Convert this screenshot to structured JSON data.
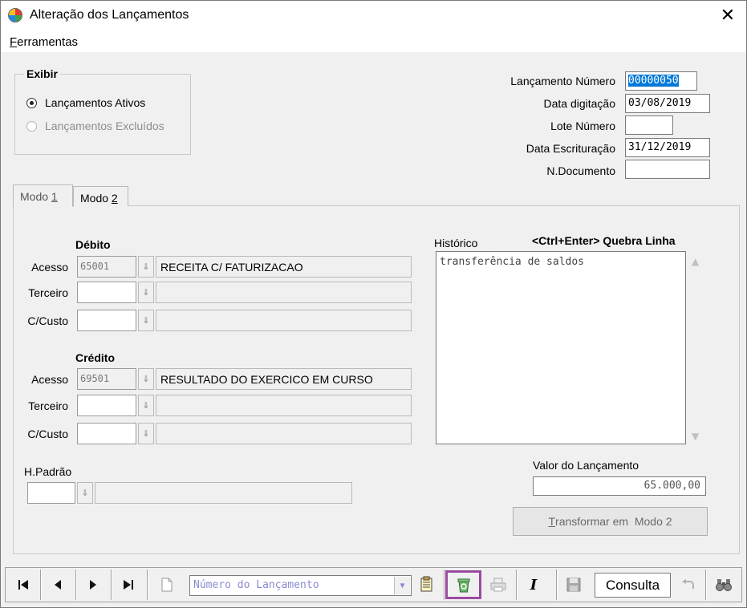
{
  "window": {
    "title": "Alteração dos Lançamentos",
    "close_glyph": "✕"
  },
  "menu": {
    "ferramentas_first": "F",
    "ferramentas_rest": "erramentas"
  },
  "exibir": {
    "title": "Exibir",
    "options": [
      {
        "label": "Lançamentos Ativos",
        "checked": true,
        "enabled": true
      },
      {
        "label": "Lançamentos Excluídos",
        "checked": false,
        "enabled": false
      }
    ]
  },
  "header_fields": {
    "lancamento_numero": {
      "label": "Lançamento Número",
      "value": "00000050"
    },
    "data_digitacao": {
      "label": "Data digitação",
      "value": "03/08/2019"
    },
    "lote_numero": {
      "label": "Lote Número",
      "value": ""
    },
    "data_escrituracao": {
      "label": "Data Escrituração",
      "value": "31/12/2019"
    },
    "n_documento": {
      "label": "N.Documento",
      "value": ""
    }
  },
  "tabs": [
    {
      "pre": "Modo ",
      "key": "1",
      "active": true
    },
    {
      "pre": "Modo ",
      "key": "2",
      "active": false
    }
  ],
  "debito": {
    "title": "Débito",
    "acesso": {
      "label": "Acesso",
      "code": "65001",
      "desc": "RECEITA C/ FATURIZACAO"
    },
    "terceiro": {
      "label": "Terceiro",
      "code": "",
      "desc": ""
    },
    "ccusto": {
      "label": "C/Custo",
      "code": "",
      "desc": ""
    }
  },
  "credito": {
    "title": "Crédito",
    "acesso": {
      "label": "Acesso",
      "code": "69501",
      "desc": "RESULTADO DO EXERCICO EM CURSO"
    },
    "terceiro": {
      "label": "Terceiro",
      "code": "",
      "desc": ""
    },
    "ccusto": {
      "label": "C/Custo",
      "code": "",
      "desc": ""
    }
  },
  "hpadrao": {
    "label": "H.Padrão",
    "code": "",
    "desc": ""
  },
  "historico": {
    "label": "Histórico",
    "hint": "<Ctrl+Enter> Quebra Linha",
    "text": "transferência de saldos"
  },
  "valor": {
    "label": "Valor do Lançamento",
    "value": "65.000,00"
  },
  "transformar": {
    "first": "T",
    "rest": "ransformar em  Modo 2"
  },
  "toolbar": {
    "combo_placeholder": "Número do Lançamento",
    "consulta": "Consulta",
    "icons": [
      "first-record-icon",
      "prev-record-icon",
      "next-record-icon",
      "last-record-icon",
      "new-document-icon",
      "notepad-icon",
      "recycle-bin-icon",
      "printer-icon",
      "italic-icon",
      "save-icon",
      "undo-icon",
      "binoculars-icon"
    ]
  }
}
